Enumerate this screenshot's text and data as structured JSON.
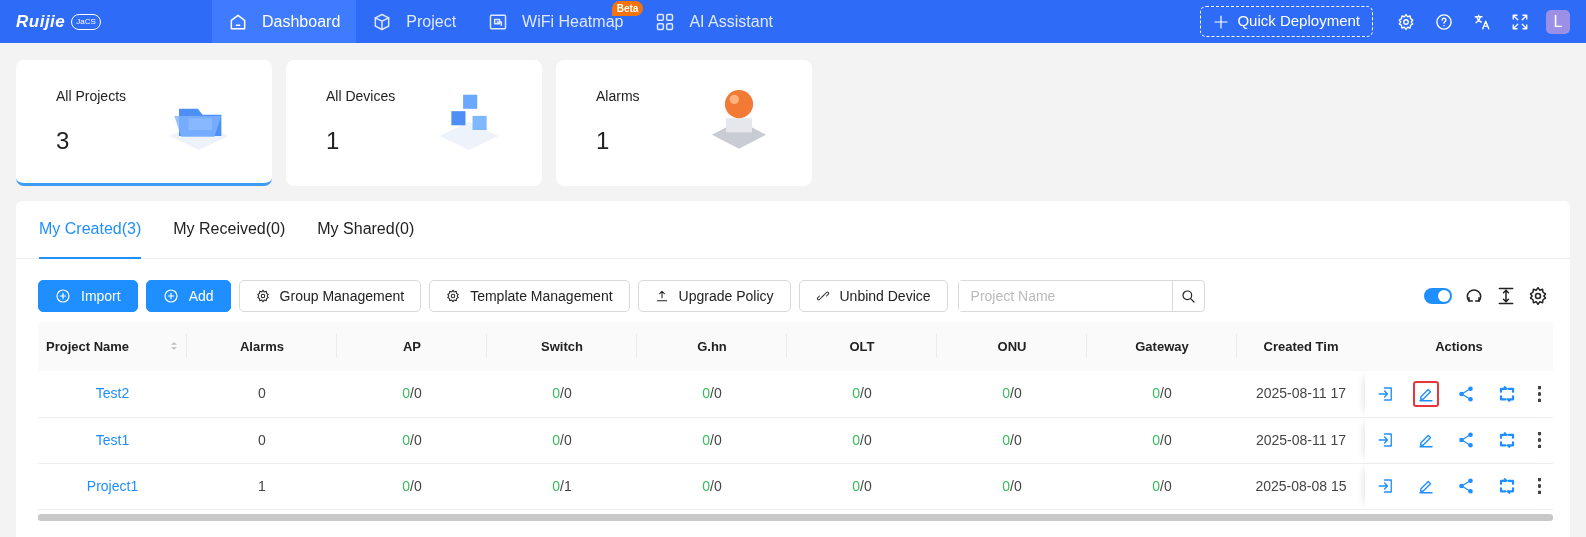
{
  "brand": {
    "logo": "Ruijie",
    "badge": "JaCS"
  },
  "nav": [
    {
      "label": "Dashboard",
      "selected": true
    },
    {
      "label": "Project",
      "selected": false
    },
    {
      "label": "WiFi Heatmap",
      "selected": false,
      "badge": "Beta"
    },
    {
      "label": "AI Assistant",
      "selected": false
    }
  ],
  "quick_deployment": "Quick Deployment",
  "avatar": "L",
  "stats": [
    {
      "label": "All Projects",
      "value": "3",
      "selected": true
    },
    {
      "label": "All Devices",
      "value": "1",
      "selected": false
    },
    {
      "label": "Alarms",
      "value": "1",
      "selected": false
    }
  ],
  "tabs": [
    {
      "label": "My Created(3)",
      "selected": true
    },
    {
      "label": "My Received(0)",
      "selected": false
    },
    {
      "label": "My Shared(0)",
      "selected": false
    }
  ],
  "buttons": [
    {
      "label": "Import",
      "kind": "primary"
    },
    {
      "label": "Add",
      "kind": "primary"
    },
    {
      "label": "Group Management",
      "kind": "outline"
    },
    {
      "label": "Template Management",
      "kind": "outline"
    },
    {
      "label": "Upgrade Policy",
      "kind": "outline"
    },
    {
      "label": "Unbind Device",
      "kind": "outline"
    }
  ],
  "search": {
    "placeholder": "Project Name"
  },
  "auto_refresh": {
    "on": true
  },
  "table": {
    "columns": [
      "Project Name",
      "Alarms",
      "AP",
      "Switch",
      "G.hn",
      "OLT",
      "ONU",
      "Gateway",
      "Created Tim",
      "Actions"
    ],
    "rows": [
      {
        "name": "Test2",
        "alarms": "0",
        "ap": "0/0",
        "switch": "0/0",
        "ghn": "0/0",
        "olt": "0/0",
        "onu": "0/0",
        "gateway": "0/0",
        "created": "2025-08-11 17",
        "actions": [
          {
            "kind": "enter",
            "highlighted": false
          },
          {
            "kind": "edit",
            "highlighted": true
          },
          {
            "kind": "share",
            "highlighted": false
          },
          {
            "kind": "swap",
            "highlighted": false
          },
          {
            "kind": "more",
            "highlighted": false
          }
        ]
      },
      {
        "name": "Test1",
        "alarms": "0",
        "ap": "0/0",
        "switch": "0/0",
        "ghn": "0/0",
        "olt": "0/0",
        "onu": "0/0",
        "gateway": "0/0",
        "created": "2025-08-11 17",
        "actions": [
          {
            "kind": "enter",
            "highlighted": false
          },
          {
            "kind": "edit",
            "highlighted": false
          },
          {
            "kind": "share",
            "highlighted": false
          },
          {
            "kind": "swap",
            "highlighted": false
          },
          {
            "kind": "more",
            "highlighted": false
          }
        ]
      },
      {
        "name": "Project1",
        "alarms": "1",
        "ap": "0/0",
        "switch": "0/1",
        "ghn": "0/0",
        "olt": "0/0",
        "onu": "0/0",
        "gateway": "0/0",
        "created": "2025-08-08 15",
        "actions": [
          {
            "kind": "enter",
            "highlighted": false
          },
          {
            "kind": "edit",
            "highlighted": false
          },
          {
            "kind": "share",
            "highlighted": false
          },
          {
            "kind": "swap",
            "highlighted": false
          },
          {
            "kind": "more",
            "highlighted": false
          }
        ]
      }
    ]
  }
}
